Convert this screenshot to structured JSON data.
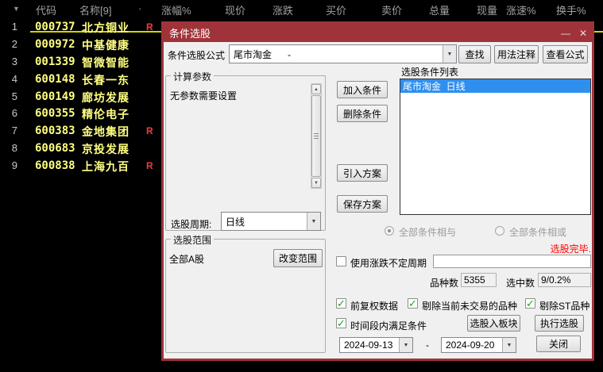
{
  "colors": {
    "titlebar-red": "#A0333A",
    "selection-blue": "#2F8FEF",
    "status-red": "#FF0000",
    "check-green": "#1CA51C",
    "stock-yellow": "#FFFF82",
    "marker-red": "#F23B3B",
    "underline-yellow": "#D4D400"
  },
  "stock_table": {
    "sort_indicator": "▼",
    "header": [
      "代码",
      "名称[9]",
      "·",
      "涨幅%",
      "现价",
      "涨跌",
      "买价",
      "卖价",
      "总量",
      "现量",
      "涨速%",
      "换手%"
    ],
    "rows": [
      {
        "num": "1",
        "code": "000737",
        "name": "北方铜业",
        "marker": "R"
      },
      {
        "num": "2",
        "code": "000972",
        "name": "中基健康",
        "marker": ""
      },
      {
        "num": "3",
        "code": "001339",
        "name": "智微智能",
        "marker": ""
      },
      {
        "num": "4",
        "code": "600148",
        "name": "长春一东",
        "marker": ""
      },
      {
        "num": "5",
        "code": "600149",
        "name": "廊坊发展",
        "marker": ""
      },
      {
        "num": "6",
        "code": "600355",
        "name": "精伦电子",
        "marker": ""
      },
      {
        "num": "7",
        "code": "600383",
        "name": "金地集团",
        "marker": "R"
      },
      {
        "num": "8",
        "code": "600683",
        "name": "京投发展",
        "marker": ""
      },
      {
        "num": "9",
        "code": "600838",
        "name": "上海九百",
        "marker": "R"
      }
    ]
  },
  "dialog": {
    "title": "条件选股",
    "titlebar": {
      "minimize": "—",
      "close": "✕"
    },
    "formula": {
      "label": "条件选股公式",
      "value": "尾市淘金      -"
    },
    "buttons": {
      "find": "查找",
      "usage": "用法注释",
      "view_formula": "查看公式",
      "add_condition": "加入条件",
      "remove_condition": "删除条件",
      "import_plan": "引入方案",
      "save_plan": "保存方案",
      "change_scope": "改变范围",
      "pick_to_block": "选股入板块",
      "execute": "执行选股",
      "close": "关闭"
    },
    "params_group": {
      "title": "计算参数",
      "empty_text": "无参数需要设置",
      "period_label": "选股周期:",
      "period_value": "日线"
    },
    "scope_group": {
      "title": "选股范围",
      "value": "全部A股"
    },
    "condition_list": {
      "label": "选股条件列表",
      "items": [
        {
          "text": "尾市淘金  日线",
          "selected": true
        }
      ]
    },
    "radios": {
      "and_label": "全部条件相与",
      "and_selected": true,
      "or_label": "全部条件相或",
      "or_selected": false
    },
    "status_text": "选股完毕.",
    "options": {
      "variable_period": {
        "label": "使用涨跌不定周期",
        "checked": false,
        "value": ""
      },
      "fuquan": {
        "label": "前复权数据",
        "checked": true
      },
      "exclude_untraded": {
        "label": "剔除当前未交易的品种",
        "checked": true
      },
      "exclude_st": {
        "label": "剔除ST品种",
        "checked": true
      },
      "time_range": {
        "label": "时间段内满足条件",
        "checked": true
      }
    },
    "counts": {
      "total_label": "品种数",
      "total_value": "5355",
      "selected_label": "选中数",
      "selected_value": "9/0.2%"
    },
    "dates": {
      "start": "2024-09-13",
      "separator": "-",
      "end": "2024-09-20"
    }
  }
}
